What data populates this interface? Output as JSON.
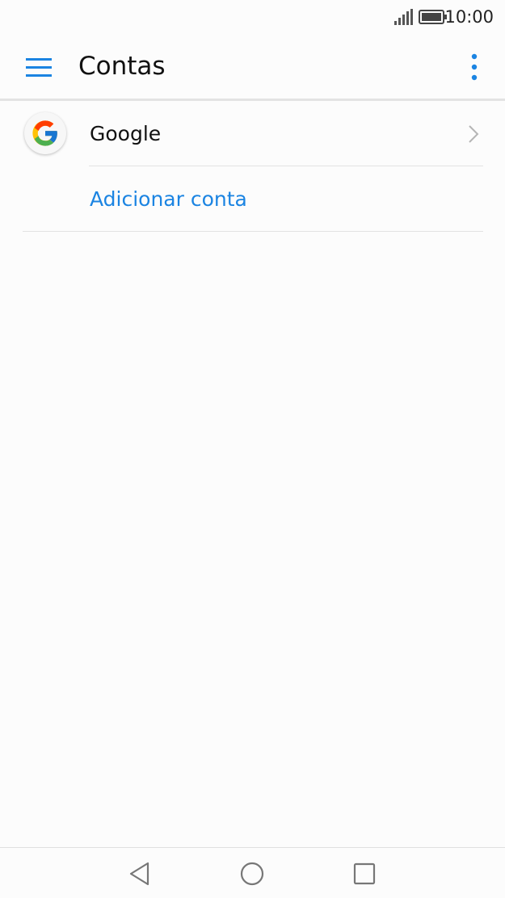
{
  "status_bar": {
    "time": "10:00",
    "icons": [
      "signal-icon",
      "battery-icon"
    ]
  },
  "app_bar": {
    "title": "Contas",
    "menu_icon": "menu-icon",
    "more_icon": "more-vert-icon"
  },
  "accounts": {
    "items": [
      {
        "label": "Google",
        "icon": "google-icon"
      }
    ],
    "add_account_label": "Adicionar conta"
  },
  "nav_bar": {
    "buttons": [
      "back-icon",
      "home-icon",
      "recent-apps-icon"
    ]
  },
  "colors": {
    "accent": "#1b84e2",
    "text": "#111111",
    "background": "#fcfcfc"
  }
}
